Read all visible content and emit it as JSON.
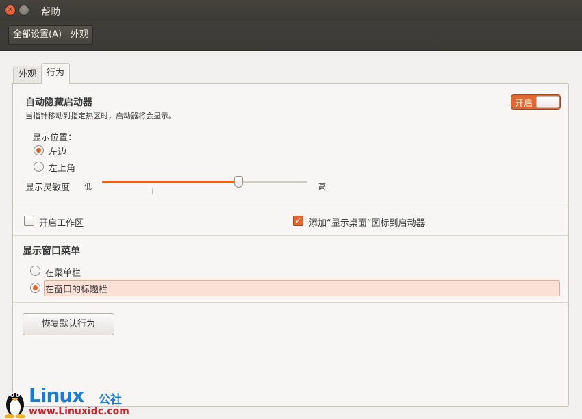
{
  "window": {
    "title": "帮助"
  },
  "toolbar": {
    "crumbs": [
      "全部设置(A)",
      "外观"
    ]
  },
  "tabs": [
    "外观",
    "行为"
  ],
  "autohide": {
    "title": "自动隐藏启动器",
    "description": "当指针移动到指定热区时，启动器将会显示。",
    "switch_label": "开启",
    "switch_on": true,
    "position_label": "显示位置：",
    "positions": [
      "左边",
      "左上角"
    ],
    "selected_position": "左边",
    "sensitivity_label": "显示灵敏度",
    "sensitivity_low": "低",
    "sensitivity_high": "高",
    "sensitivity_value": 0.66
  },
  "options": {
    "workspaces_label": "开启工作区",
    "workspaces_checked": false,
    "show_desktop_label": "添加“显示桌面”图标到启动器",
    "show_desktop_checked": true
  },
  "window_menu": {
    "title": "显示窗口菜单",
    "options": [
      "在菜单栏",
      "在窗口的标题栏"
    ],
    "selected": "在窗口的标题栏"
  },
  "restore_button": "恢复默认行为",
  "watermark": {
    "logo": "Linux",
    "suffix": "公社",
    "url": "www.Linuxidc.com"
  },
  "colors": {
    "accent": "#e2672f",
    "titlebar": "#3c3b37",
    "link_blue": "#1b7bd0",
    "url_red": "#d2232a"
  }
}
